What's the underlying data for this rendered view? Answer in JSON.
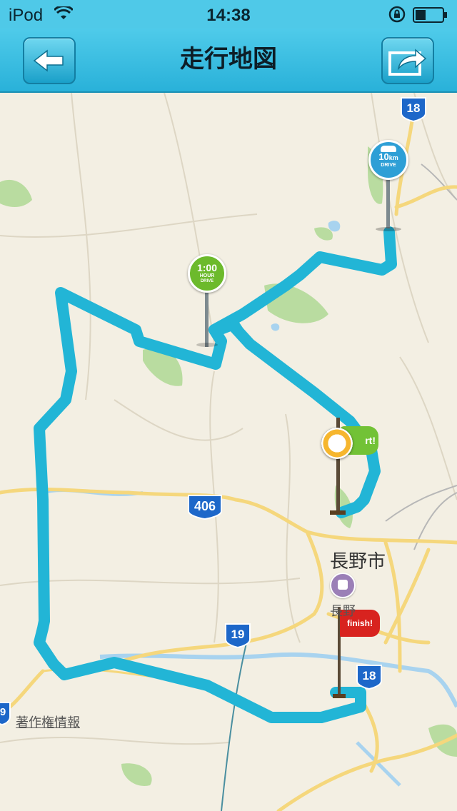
{
  "status_bar": {
    "carrier": "iPod",
    "time": "14:38"
  },
  "nav": {
    "title": "走行地図",
    "back_icon": "arrow-left",
    "share_icon": "share-arrow"
  },
  "map": {
    "city": "長野市",
    "station": "長野",
    "copyright": "著作権情報",
    "routes": [
      "18",
      "406",
      "19",
      "18"
    ],
    "side_route": "9",
    "markers": {
      "distance": {
        "value": "10",
        "unit": "km",
        "label": "DRIVE"
      },
      "time": {
        "value": "1:00",
        "line1": "HOUR",
        "line2": "DRIVE"
      },
      "start": {
        "label": "rt!"
      },
      "finish": {
        "label": "finish!"
      }
    },
    "route_color": "#22b5d6",
    "road_color": "#f5d77c"
  }
}
